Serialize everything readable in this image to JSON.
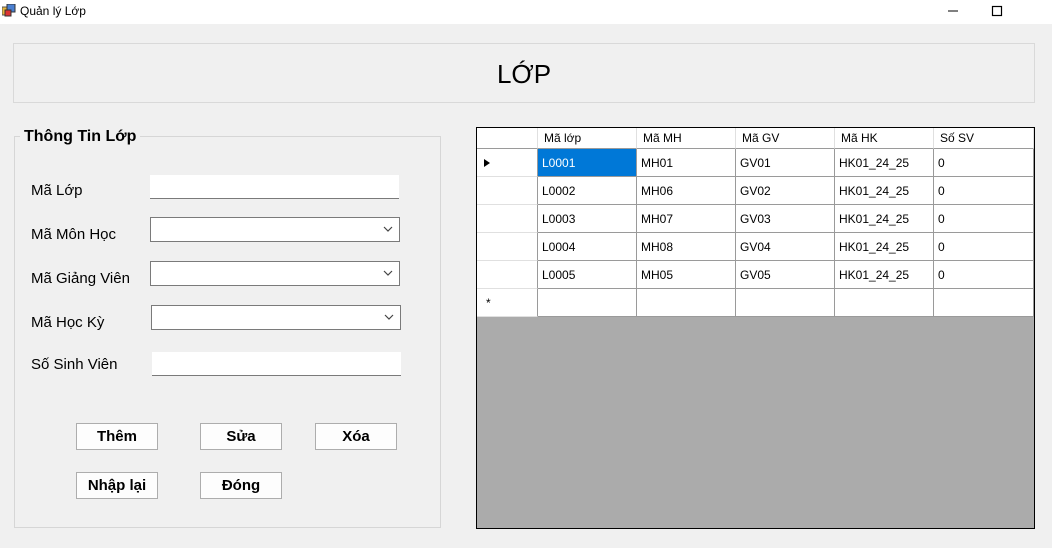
{
  "window": {
    "title": "Quản lý Lớp"
  },
  "header": {
    "title": "LỚP"
  },
  "form": {
    "group_title": "Thông Tin Lớp",
    "fields": {
      "ma_lop": {
        "label": "Mã Lớp",
        "value": ""
      },
      "ma_mon_hoc": {
        "label": "Mã Môn Học",
        "value": ""
      },
      "ma_giang_vien": {
        "label": "Mã Giảng Viên",
        "value": ""
      },
      "ma_hoc_ky": {
        "label": "Mã Học Kỳ",
        "value": ""
      },
      "so_sinh_vien": {
        "label": "Số Sinh Viên",
        "value": ""
      }
    },
    "buttons": {
      "them": "Thêm",
      "sua": "Sửa",
      "xoa": "Xóa",
      "nhap_lai": "Nhập lại",
      "dong": "Đóng"
    }
  },
  "grid": {
    "columns": [
      "Mã lớp",
      "Mã MH",
      "Mã GV",
      "Mã HK",
      "Số SV"
    ],
    "rows": [
      [
        "L0001",
        "MH01",
        "GV01",
        "HK01_24_25",
        "0"
      ],
      [
        "L0002",
        "MH06",
        "GV02",
        "HK01_24_25",
        "0"
      ],
      [
        "L0003",
        "MH07",
        "GV03",
        "HK01_24_25",
        "0"
      ],
      [
        "L0004",
        "MH08",
        "GV04",
        "HK01_24_25",
        "0"
      ],
      [
        "L0005",
        "MH05",
        "GV05",
        "HK01_24_25",
        "0"
      ]
    ],
    "new_row_marker": "*",
    "selected_color": "#0078d7",
    "empty_area_color": "#ababab"
  }
}
